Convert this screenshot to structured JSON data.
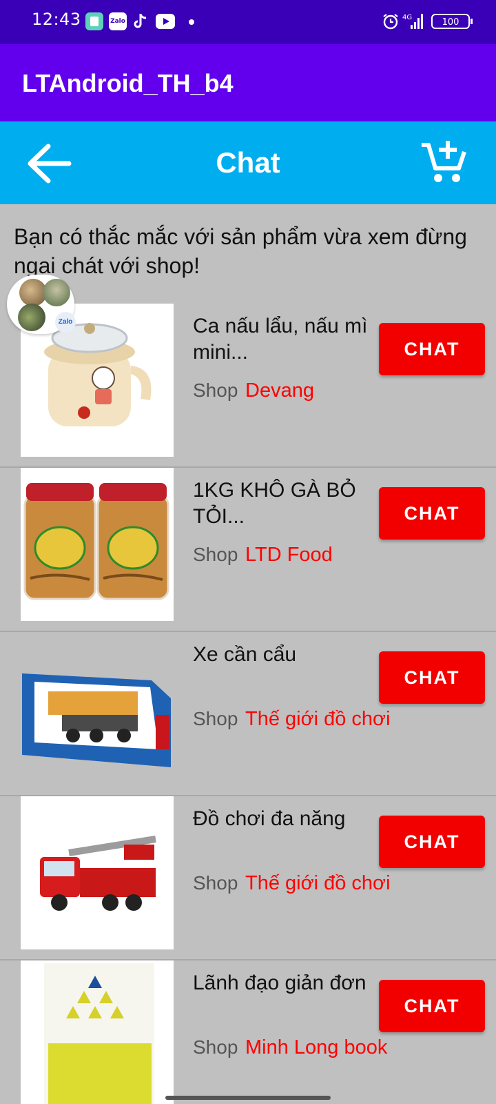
{
  "status_bar": {
    "time": "12:43",
    "icons": [
      "sheets-app-icon",
      "zalo-icon",
      "tiktok-icon",
      "youtube-icon",
      "notification-dot-icon",
      "alarm-icon",
      "signal-4g-icon",
      "battery-icon"
    ],
    "network": "4G",
    "battery": "100"
  },
  "app_bar": {
    "title": "LTAndroid_TH_b4"
  },
  "toolbar": {
    "title": "Chat",
    "back_icon": "arrow-left-icon",
    "cart_icon": "cart-add-icon"
  },
  "intro": {
    "text": "Bạn có thắc mắc với sản phẩm vừa xem đừng ngại chát với shop!"
  },
  "chat_head": {
    "badge": "Zalo"
  },
  "items": [
    {
      "title": "Ca nấu lẩu, nấu mì mini...",
      "shop_label": "Shop",
      "shop": "Devang",
      "button": "CHAT",
      "image": "electric-pot-image"
    },
    {
      "title": "1KG KHÔ GÀ BỎ TỎI...",
      "shop_label": "Shop",
      "shop": "LTD Food",
      "button": "CHAT",
      "image": "dried-chicken-jars-image"
    },
    {
      "title": "Xe cần cẩu",
      "shop_label": "Shop",
      "shop": "Thế giới đồ chơi",
      "button": "CHAT",
      "image": "crane-truck-toy-image"
    },
    {
      "title": "Đồ chơi đa năng",
      "shop_label": "Shop",
      "shop": "Thế giới đồ chơi",
      "button": "CHAT",
      "image": "fire-truck-toy-image"
    },
    {
      "title": "Lãnh đạo giản đơn",
      "shop_label": "Shop",
      "shop": "Minh Long book",
      "button": "CHAT",
      "image": "book-cover-image"
    }
  ],
  "colors": {
    "status_bar": "#3a00b8",
    "app_bar": "#6200ee",
    "toolbar": "#00aeef",
    "background": "#c0c0c0",
    "chat_button": "#f20000",
    "shop_name": "#ff0000"
  }
}
